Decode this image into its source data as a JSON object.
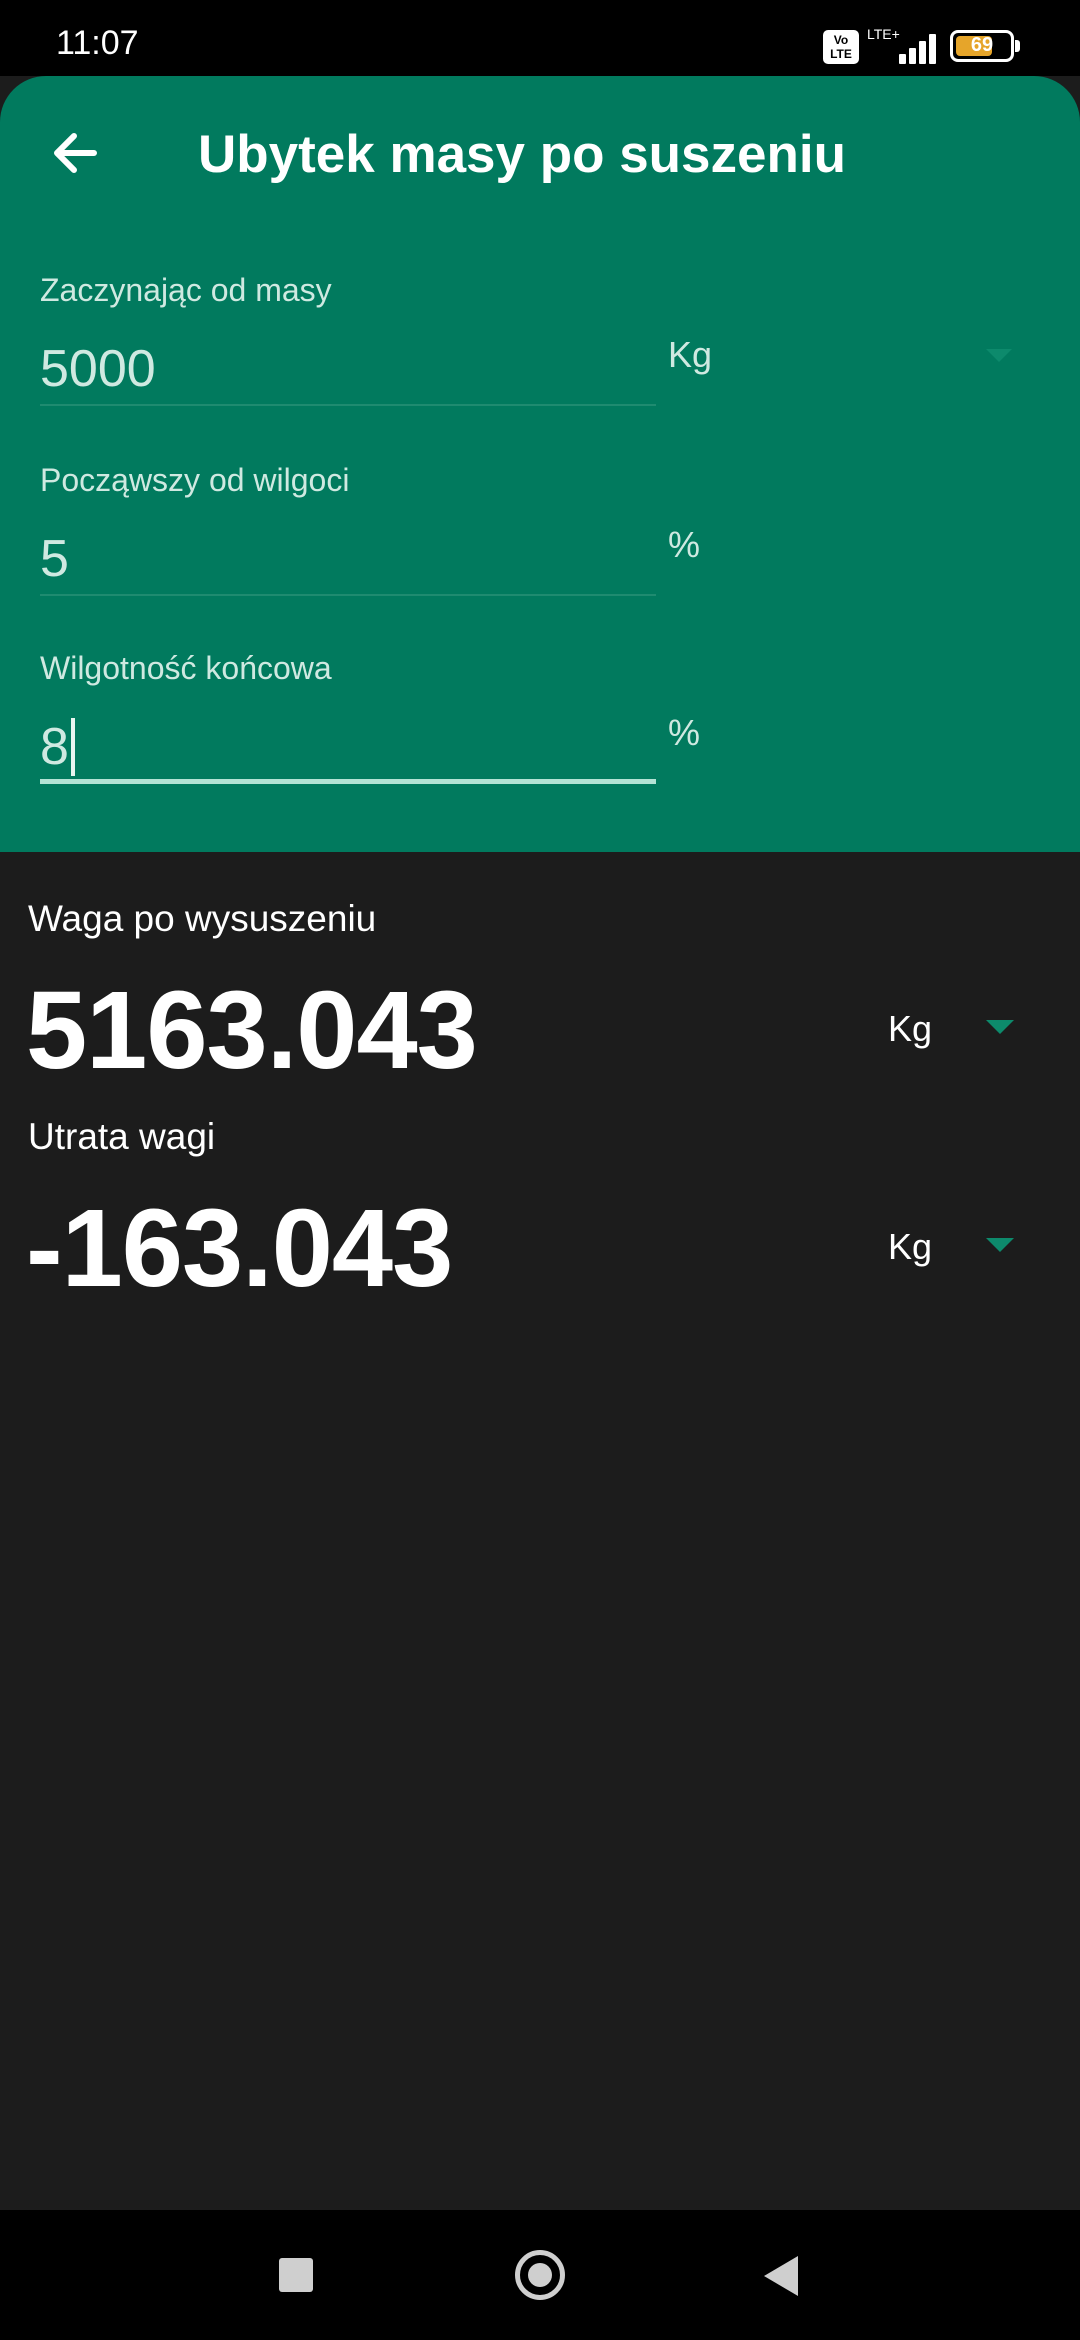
{
  "status_bar": {
    "time": "11:07",
    "volte_icon": "VoLTE",
    "network_type": "LTE+",
    "signal_icon": "cellular-signal-icon",
    "battery_level": "69",
    "battery_color": "#e6a52a"
  },
  "header": {
    "back_icon": "arrow-left-icon",
    "title": "Ubytek masy po suszeniu",
    "background_color": "#017a5e"
  },
  "inputs": [
    {
      "label": "Zaczynając od masy",
      "value": "5000",
      "unit": "Kg",
      "has_dropdown": true
    },
    {
      "label": "Począwszy od wilgoci",
      "value": "5",
      "unit": "%",
      "has_dropdown": false
    },
    {
      "label": "Wilgotność końcowa",
      "value": "8",
      "unit": "%",
      "has_dropdown": false,
      "focused": true
    }
  ],
  "results": [
    {
      "label": "Waga po wysuszeniu",
      "value": "5163.043",
      "unit": "Kg"
    },
    {
      "label": "Utrata wagi",
      "value": "-163.043",
      "unit": "Kg"
    }
  ],
  "nav_bar": {
    "recent_icon": "square-recents-icon",
    "home_icon": "circle-home-icon",
    "back_icon": "triangle-back-icon"
  },
  "colors": {
    "accent": "#0d8a6c",
    "background": "#1c1c1c"
  }
}
